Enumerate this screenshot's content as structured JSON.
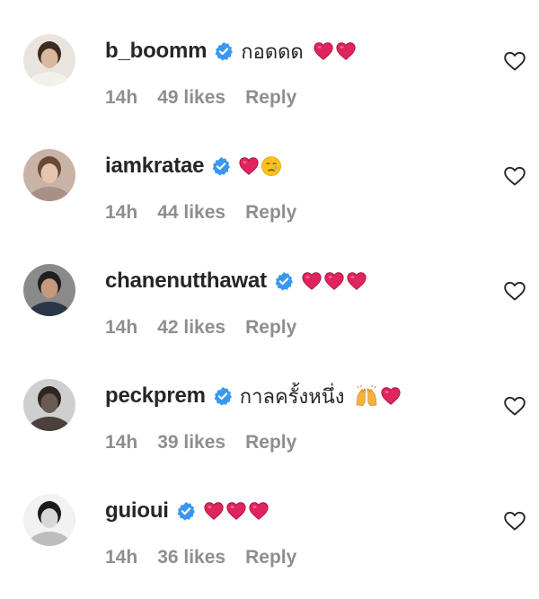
{
  "comments": [
    {
      "username": "b_boomm",
      "text": "กอดดด",
      "emoji": [
        "heart",
        "heart"
      ],
      "time": "14h",
      "likes": "49 likes",
      "reply": "Reply",
      "avatar": {
        "bg": "#e9e4de",
        "face": "#d9b8a0",
        "hair": "#3b2b20",
        "cloth": "#f4f1ec"
      }
    },
    {
      "username": "iamkratae",
      "text": "",
      "emoji": [
        "heart",
        "crying"
      ],
      "time": "14h",
      "likes": "44 likes",
      "reply": "Reply",
      "avatar": {
        "bg": "#c9b2a6",
        "face": "#e6c6b0",
        "hair": "#6a4a36",
        "cloth": "#a89086"
      }
    },
    {
      "username": "chanenutthawat",
      "text": "",
      "emoji": [
        "heart",
        "heart",
        "heart"
      ],
      "time": "14h",
      "likes": "42 likes",
      "reply": "Reply",
      "avatar": {
        "bg": "#8a8a8a",
        "face": "#c59a7c",
        "hair": "#1f1f1f",
        "cloth": "#2a3548"
      }
    },
    {
      "username": "peckprem",
      "text": "กาลครั้งหนึ่ง",
      "emoji": [
        "raised-hands",
        "heart"
      ],
      "time": "14h",
      "likes": "39 likes",
      "reply": "Reply",
      "avatar": {
        "bg": "#cfcfcf",
        "face": "#6a5a52",
        "hair": "#2e2622",
        "cloth": "#4a403c"
      }
    },
    {
      "username": "guioui",
      "text": "",
      "emoji": [
        "heart",
        "heart",
        "heart"
      ],
      "time": "14h",
      "likes": "36 likes",
      "reply": "Reply",
      "avatar": {
        "bg": "#f2f2f2",
        "face": "#d8d8d8",
        "hair": "#1b1b1b",
        "cloth": "#bdbdbd"
      }
    }
  ],
  "icons": {
    "verified": "verified-badge-icon",
    "like": "heart-outline-icon"
  },
  "colors": {
    "text": "#262626",
    "meta": "#8e8e8e",
    "verified": "#3897f0",
    "heart": "#e0245e"
  }
}
